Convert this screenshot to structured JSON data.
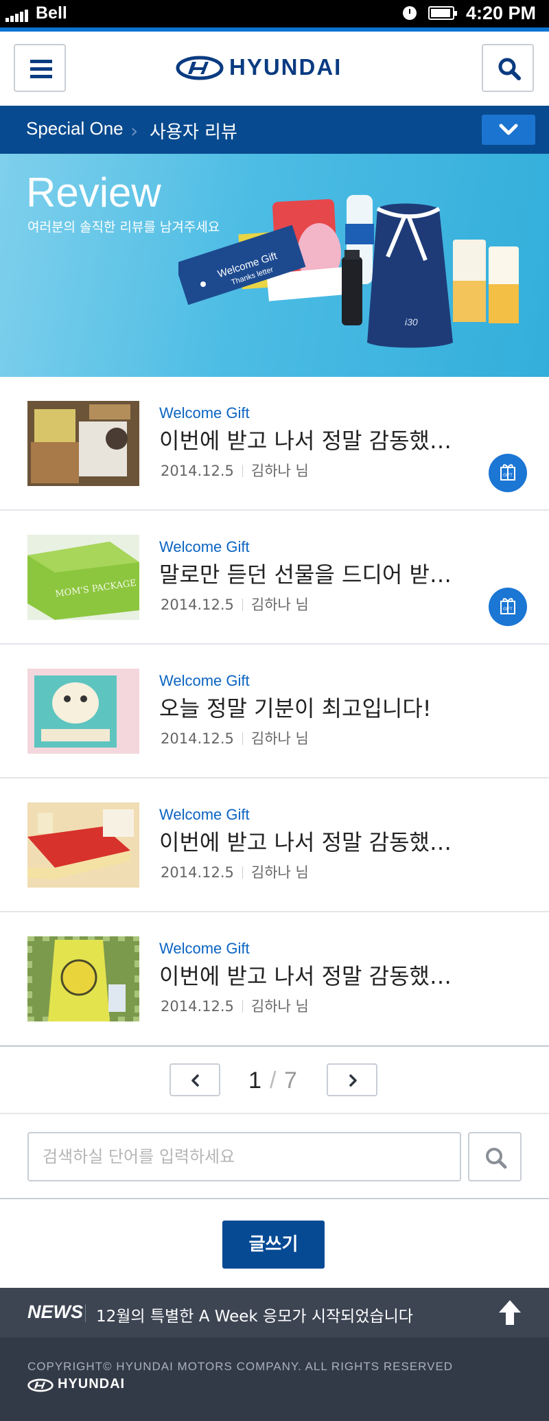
{
  "status_bar": {
    "carrier": "Bell",
    "time": "4:20 PM"
  },
  "header": {
    "logo_text": "HYUNDAI"
  },
  "breadcrumb": {
    "section": "Special One",
    "current": "사용자 리뷰"
  },
  "banner": {
    "title": "Review",
    "subtitle": "여러분의 솔직한 리뷰를 남겨주세요",
    "art_card_line1": "Welcome Gift",
    "art_card_line2": "Thanks letter"
  },
  "reviews": [
    {
      "category": "Welcome Gift",
      "title": "이번에 받고 나서 정말 감동했어요",
      "date": "2014.12.5",
      "author": "김하나 님",
      "gift_badge": true
    },
    {
      "category": "Welcome Gift",
      "title": "말로만 듣던 선물을 드디어 받았어요",
      "date": "2014.12.5",
      "author": "김하나 님",
      "gift_badge": true
    },
    {
      "category": "Welcome Gift",
      "title": "오늘 정말 기분이 최고입니다!",
      "date": "2014.12.5",
      "author": "김하나 님",
      "gift_badge": false
    },
    {
      "category": "Welcome Gift",
      "title": "이번에 받고 나서 정말 감동했어요",
      "date": "2014.12.5",
      "author": "김하나 님",
      "gift_badge": false
    },
    {
      "category": "Welcome Gift",
      "title": "이번에 받고 나서 정말 감동했어요",
      "date": "2014.12.5",
      "author": "김하나 님",
      "gift_badge": false
    }
  ],
  "gift_badge_label": "GIFT",
  "pagination": {
    "current": "1",
    "separator": "/",
    "total": "7"
  },
  "search": {
    "placeholder": "검색하실 단어를 입력하세요",
    "value": ""
  },
  "write_button": "글쓰기",
  "news": {
    "label": "NEWS",
    "text": "12월의 특별한 A Week 응모가 시작되었습니다"
  },
  "footer": {
    "copyright": "COPYRIGHT© HYUNDAI MOTORS COMPANY. ALL RIGHTS RESERVED",
    "logo_text": "HYUNDAI"
  },
  "colors": {
    "brand": "#0a3b81",
    "accent": "#1b76d4",
    "crumb_bar": "#084a8f",
    "news_bar": "#3d4553",
    "footer": "#333a47"
  },
  "icons": [
    "signal-icon",
    "clock-icon",
    "battery-icon",
    "menu-icon",
    "hyundai-logo-icon",
    "search-icon",
    "chevron-down-icon",
    "gift-icon",
    "chevron-left-icon",
    "chevron-right-icon",
    "arrow-up-icon"
  ]
}
